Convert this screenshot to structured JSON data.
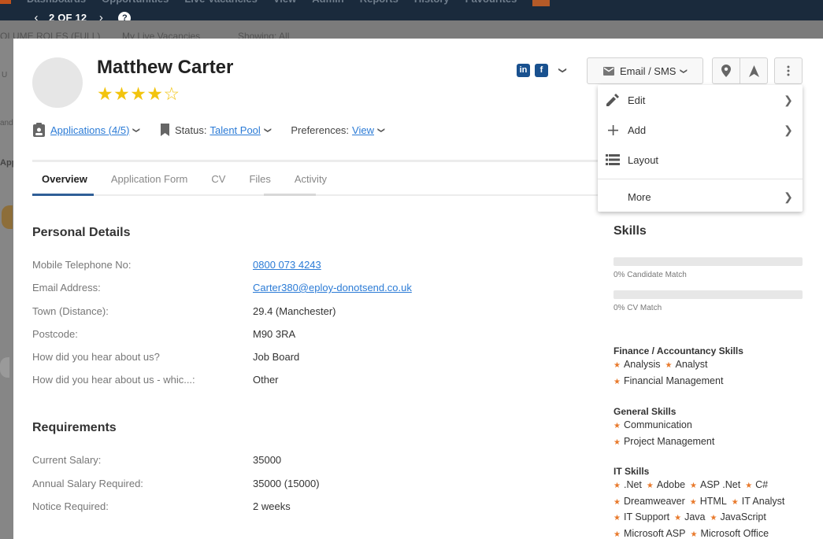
{
  "topnav": {
    "items": [
      "Dashboards",
      "Opportunities",
      "Live Vacancies",
      "View",
      "Admin",
      "Reports",
      "History",
      "Favourites"
    ]
  },
  "pager": {
    "prev": "‹",
    "next": "›",
    "count": "2 OF 12",
    "help": "?"
  },
  "background_tabs": [
    "OLUME ROLES (FULL)",
    "My Live Vacancies",
    "Showing: All"
  ],
  "background_gutter": [
    "U",
    "and",
    "Appl"
  ],
  "candidate": {
    "name": "Matthew Carter",
    "rating": 4,
    "rating_max": 5
  },
  "infobar": {
    "applications": "Applications (4/5)",
    "status_label": "Status:",
    "status_value": "Talent Pool",
    "preferences_label": "Preferences:",
    "preferences_value": "View"
  },
  "social": {
    "linkedin": "in",
    "facebook": "f"
  },
  "actions": {
    "email_sms": "Email / SMS"
  },
  "tabs": [
    "Overview",
    "Application Form",
    "CV",
    "Files",
    "Activity"
  ],
  "personal_details": {
    "title": "Personal Details",
    "rows": [
      {
        "label": "Mobile Telephone No:",
        "value": "0800 073 4243"
      },
      {
        "label": "Email Address:",
        "value": "Carter380@eploy-donotsend.co.uk"
      },
      {
        "label": "Town (Distance):",
        "value": "29.4 (Manchester)"
      },
      {
        "label": "Postcode:",
        "value": "M90 3RA"
      },
      {
        "label": "How did you hear about us?",
        "value": "Job Board"
      },
      {
        "label": "How did you hear about us - whic...:",
        "value": "Other"
      }
    ]
  },
  "requirements": {
    "title": "Requirements",
    "rows": [
      {
        "label": "Current Salary:",
        "value": "35000"
      },
      {
        "label": "Annual Salary Required:",
        "value": "35000 (15000)"
      },
      {
        "label": "Notice Required:",
        "value": "2 weeks"
      }
    ]
  },
  "skills": {
    "title": "Skills",
    "candidate_match": "0% Candidate Match",
    "cv_match": "0% CV Match",
    "groups": [
      {
        "title": "Finance / Accountancy Skills",
        "items": [
          "Analysis",
          "Analyst",
          "Financial Management"
        ]
      },
      {
        "title": "General Skills",
        "items": [
          "Communication",
          "Project Management"
        ]
      },
      {
        "title": "IT Skills",
        "items": [
          ".Net",
          "Adobe",
          "ASP .Net",
          "C#",
          "Dreamweaver",
          "HTML",
          "IT Analyst",
          "IT Support",
          "Java",
          "JavaScript",
          "Microsoft ASP",
          "Microsoft Office"
        ]
      }
    ]
  },
  "dropdown": {
    "edit": "Edit",
    "add": "Add",
    "layout": "Layout",
    "more": "More"
  },
  "colors": {
    "nav_bg": "#1a2a3c",
    "link": "#2b7bd6",
    "star": "#f2c40e",
    "skill_star": "#e8792b",
    "tab_active": "#2f5f97"
  }
}
